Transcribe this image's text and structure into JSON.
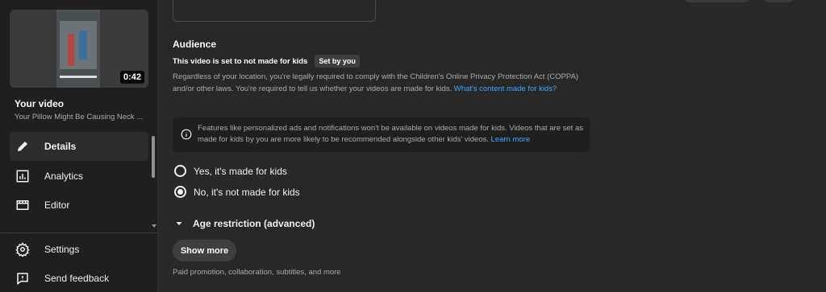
{
  "sidebar": {
    "thumbnail": {
      "duration": "0:42"
    },
    "your_video_label": "Your video",
    "video_title": "Your Pillow Might Be Causing Neck ...",
    "items": [
      {
        "label": "Details",
        "icon": "pencil-icon",
        "active": true
      },
      {
        "label": "Analytics",
        "icon": "analytics-icon",
        "active": false
      },
      {
        "label": "Editor",
        "icon": "editor-icon",
        "active": false
      },
      {
        "label": "Settings",
        "icon": "gear-icon",
        "active": false
      },
      {
        "label": "Send feedback",
        "icon": "feedback-icon",
        "active": false
      }
    ]
  },
  "audience": {
    "heading": "Audience",
    "status_text": "This video is set to not made for kids",
    "status_chip": "Set by you",
    "description": "Regardless of your location, you're legally required to comply with the Children's Online Privacy Protection Act (COPPA) and/or other laws. You're required to tell us whether your videos are made for kids.",
    "description_link": "What's content made for kids?",
    "info_text": "Features like personalized ads and notifications won't be available on videos made for kids. Videos that are set as made for kids by you are more likely to be recommended alongside other kids' videos.",
    "info_link": "Learn more",
    "options": [
      {
        "label": "Yes, it's made for kids",
        "selected": false
      },
      {
        "label": "No, it's not made for kids",
        "selected": true
      }
    ]
  },
  "age_restriction": {
    "label": "Age restriction (advanced)"
  },
  "show_more": {
    "label": "Show more",
    "caption": "Paid promotion, collaboration, subtitles, and more"
  },
  "colors": {
    "link": "#3ea6ff",
    "background": "#282828",
    "sidebar": "#1f1f1f"
  }
}
